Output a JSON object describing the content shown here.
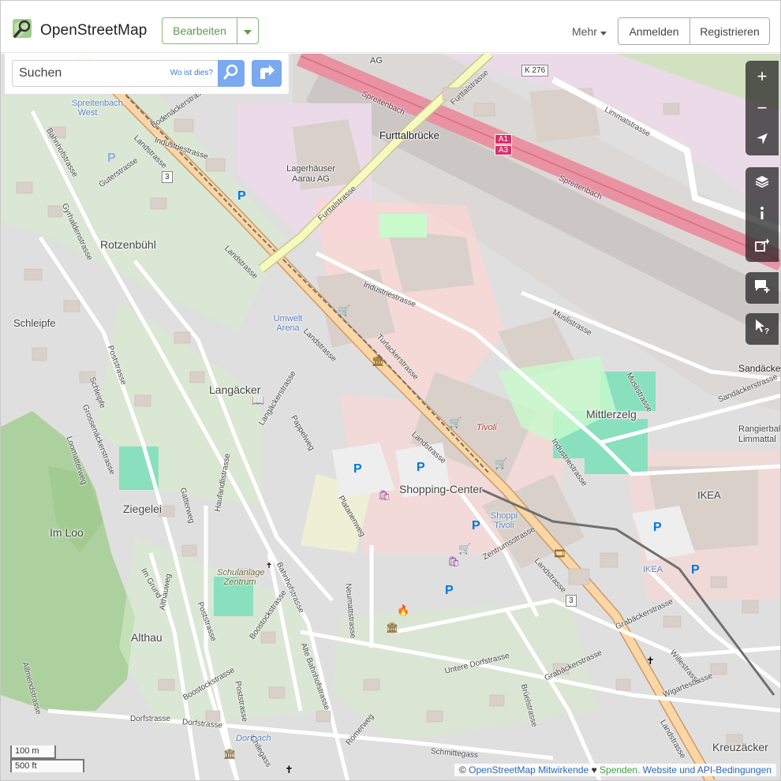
{
  "header": {
    "brand": "OpenStreetMap",
    "edit_label": "Bearbeiten",
    "more_label": "Mehr",
    "login_label": "Anmelden",
    "register_label": "Registrieren"
  },
  "search": {
    "placeholder": "Suchen",
    "where_label": "Wo ist dies?"
  },
  "controls": {
    "zoom_in": "+",
    "zoom_out": "−"
  },
  "scale": {
    "metric": "100 m",
    "imperial": "500 ft"
  },
  "attribution": {
    "copyright": "©",
    "contributors": "OpenStreetMap Mitwirkende",
    "heart": "♥",
    "donate": "Spenden.",
    "terms": "Website und API-Bedingungen"
  },
  "map": {
    "places": {
      "spreitenbach_west": "Spreitenbach West",
      "furttalbruecke": "Furttalbrücke",
      "lagerhaeuser": "Lagerhäuser Aarau AG",
      "rotzenbuehl": "Rotzenbühl",
      "schleipfe": "Schleipfe",
      "langaecker": "Langäcker",
      "umwelt_arena": "Umwelt Arena",
      "tivoli": "Tivoli",
      "mittlerzelg": "Mittlerzelg",
      "sandaecker": "Sandäcke",
      "rangierbahnhof": "Rangierbahnho Limmattal",
      "shopping_center": "Shopping-Center",
      "shoppi_tivoli": "Shoppi Tivoli",
      "ikea": "IKEA",
      "ikea_stop": "IKEA",
      "ziegelei": "Ziegelei",
      "im_loo": "Im Loo",
      "althau": "Althau",
      "schulanlage": "Schulanlage Zentrum",
      "kreuzaecker": "Kreuzäcker",
      "ag": "AG",
      "dorfbach": "Dorfbach"
    },
    "streets": {
      "landstrasse": "Landstrasse",
      "furttalstrasse": "Furttalstrasse",
      "limmatstrasse": "Limmatstrasse",
      "industriestrasse": "Industriestrasse",
      "muslistrasse": "Muslistrasse",
      "sandaeckerstrasse": "Sandäckerstrasse",
      "bahnhofstrasse": "Bahnhofstrasse",
      "poststrasse": "Poststrasse",
      "dorfstrasse": "Dorfstrasse",
      "untere_dorfstrasse": "Untere Dorfstrasse",
      "zentrumsstrasse": "Zentrumsstrasse",
      "pappelweg": "Pappelweg",
      "platanenweg": "Platanenweg",
      "neumattstrasse": "Neumattstrasse",
      "grabaeckerstrasse": "Grabäckerstrasse",
      "wigartestrasse": "Wigartestrasse",
      "willestrasse": "Willestrasse",
      "brueelstrasse": "Brüelstrasse",
      "schmittegass": "Schmittegass",
      "roemerweg": "Römerweg",
      "gyrhaldenstrasse": "Gyrhaldenstrasse",
      "guterstrasse": "Guterstrasse",
      "bodenaeckerstrasse": "Bodenäckerstrasse",
      "turlackerstrasse": "Turlackerstrasse",
      "langaeckerstrasse": "Langäckerstrasse",
      "spreitenbach": "Spreitenbach",
      "boostockstrasse": "Boostockstrasse",
      "alte_bahnhofstrasse": "Alte Bahnhofstrasse",
      "schleipfe_street": "Schleipfe",
      "gatterweg": "Gatterweg",
      "hauffandlistrasse": "Haufandlistrasse",
      "loomatterweg": "Loomatterweg",
      "grossenackerstrasse": "Grossenäckerstrasse",
      "im_grund": "Im Grund",
      "allmendstrasse": "Allmendstrasse",
      "althauweg": "Althauweg",
      "chilegass": "Chilegass"
    },
    "shields": {
      "k276": "K 276",
      "route3_a": "3",
      "route3_b": "3",
      "a1": "A1",
      "a3": "A3"
    }
  },
  "colors": {
    "osm_green": "#7ebc6f",
    "search_blue": "#7ba9ef",
    "motorway": "#e892a2",
    "primary_road": "#fcd6a4",
    "secondary_road": "#f7fabf",
    "landuse_residential": "#e0dfdf",
    "landuse_retail": "#ffd6d1",
    "landuse_industrial": "#ebdbe8",
    "park": "#c8facc",
    "railway_yard": "#d8d3d0",
    "forest": "#add19e"
  }
}
